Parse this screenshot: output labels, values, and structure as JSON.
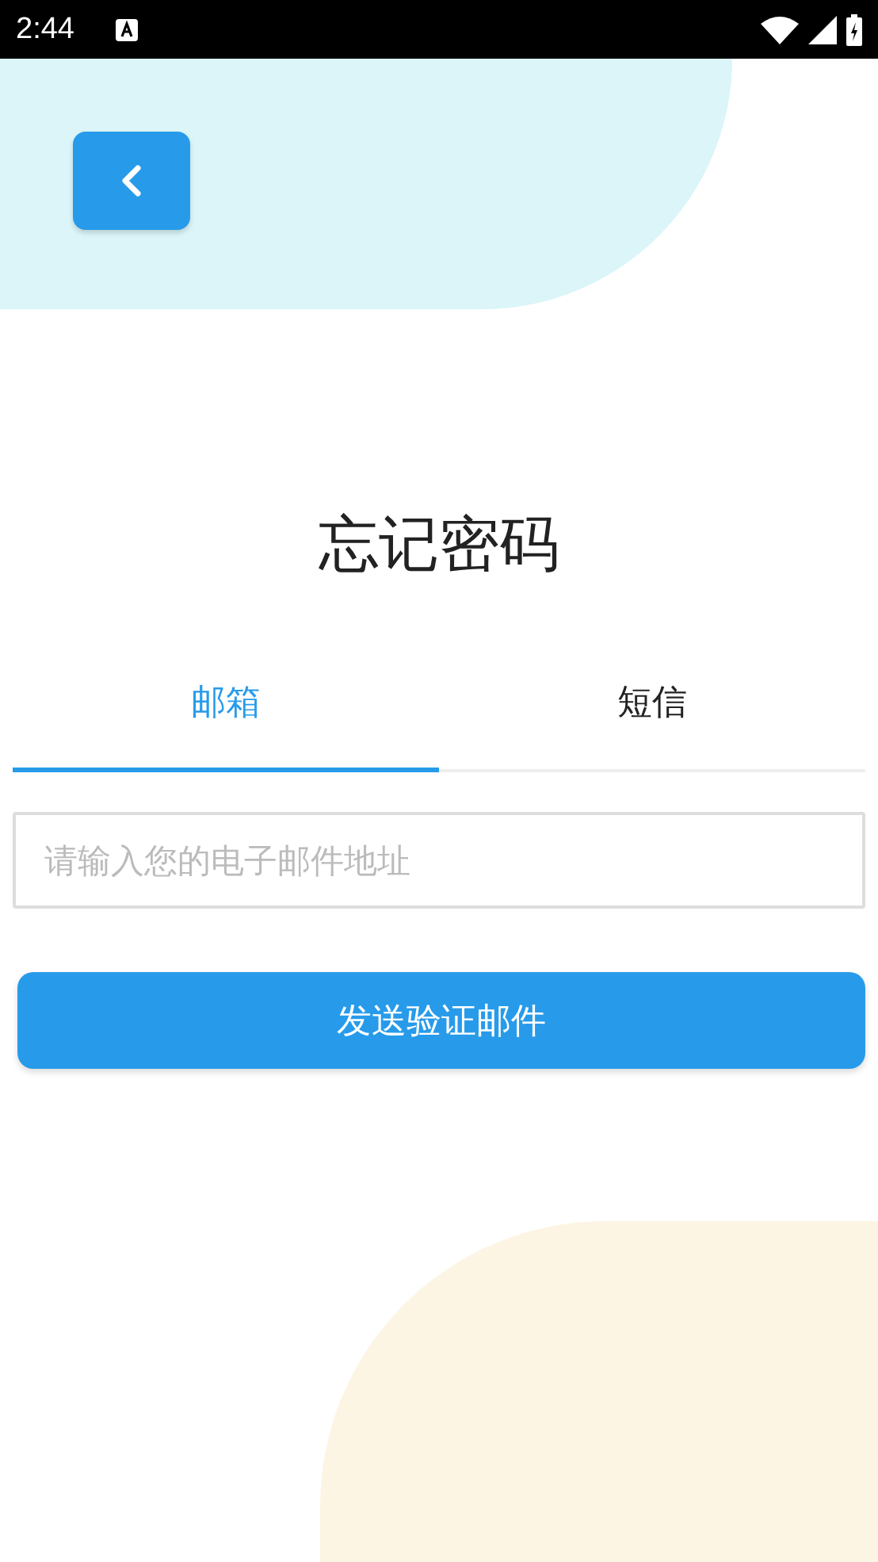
{
  "status_bar": {
    "time": "2:44"
  },
  "title": "忘记密码",
  "tabs": [
    {
      "label": "邮箱",
      "selected": true
    },
    {
      "label": "短信",
      "selected": false
    }
  ],
  "email_field": {
    "placeholder": "请输入您的电子邮件地址"
  },
  "submit_button": {
    "label": "发送验证邮件"
  }
}
